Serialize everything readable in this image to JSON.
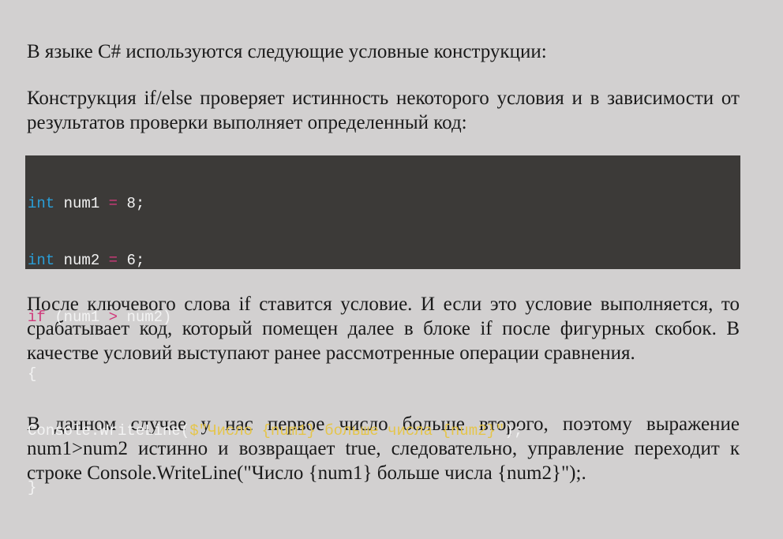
{
  "intro": "В языке C# используются следующие условные конструкции:",
  "para1": "Конструкция if/else проверяет истинность некоторого условия и в зависимости от результатов проверки выполняет определенный код:",
  "code": {
    "line1": {
      "kw": "int",
      "rest1": " num1 ",
      "op": "=",
      "rest2": " 8;"
    },
    "line2": {
      "kw": "int",
      "rest1": " num2 ",
      "op": "=",
      "rest2": " 6;"
    },
    "line3": {
      "kw": "if",
      "rest1": " (num1 ",
      "op": ">",
      "rest2": " num2)"
    },
    "line4": "{",
    "line5": {
      "pre": "Console.WriteLine(",
      "str": "$\"Число {num1} больше числа {num2}\"",
      "post": ");"
    },
    "line6": "}"
  },
  "para2": "После ключевого слова if ставится условие. И если это условие выполняется, то срабатывает код, который помещен далее в блоке if после фигурных скобок. В качестве условий выступают ранее рассмотренные операции сравнения.",
  "para3": "В данном случае у нас первое число больше второго, поэтому выражение num1>num2 истинно и возвращает true, следовательно, управление переходит к строке Console.WriteLine(\"Число {num1} больше числа {num2}\");."
}
